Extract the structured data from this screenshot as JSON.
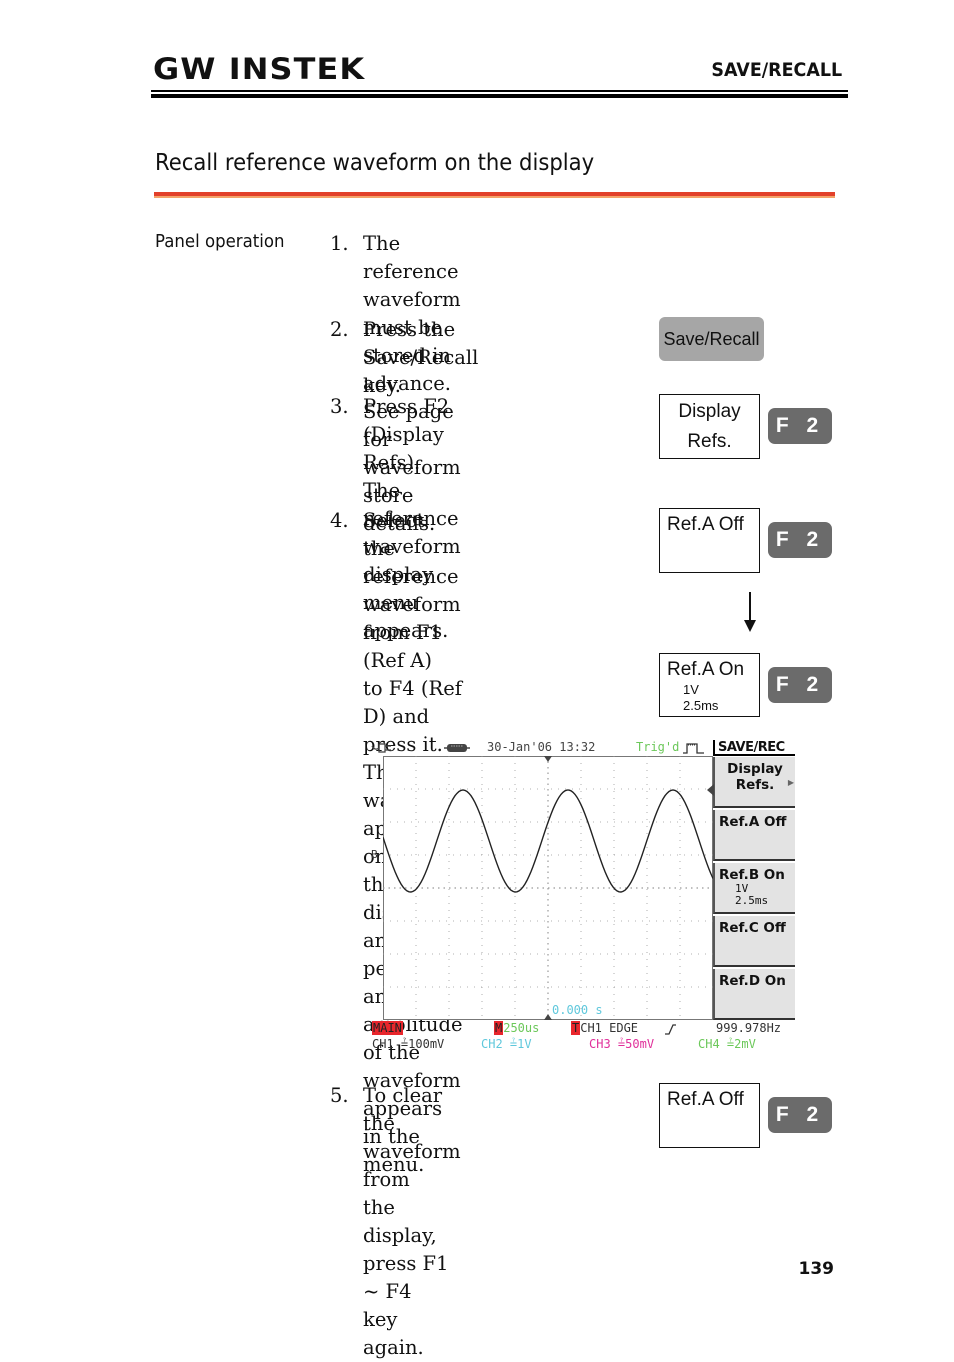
{
  "header": {
    "logo": "GW INSTEK",
    "chapter": "SAVE/RECALL"
  },
  "section": {
    "title": "Recall reference waveform on the display",
    "side_label": "Panel operation"
  },
  "steps": [
    {
      "num": "1.",
      "lines": [
        "The reference waveform must be stored in",
        "advance. See page for waveform store details."
      ]
    },
    {
      "num": "2.",
      "lines": [
        "Press the Save/Recall key."
      ]
    },
    {
      "num": "3.",
      "lines": [
        "Press F2 (Display Refs). The",
        "reference waveform display",
        "menu appears."
      ]
    },
    {
      "num": "4.",
      "lines": [
        "Select the reference",
        "waveform from F1 (Ref A)",
        "to F4 (Ref D) and press it.",
        "The waveform appears on",
        "the display and the period",
        "and amplitude of the",
        "waveform appears in the",
        "menu."
      ]
    },
    {
      "num": "5.",
      "lines": [
        "To clear the waveform from",
        "the display, press F1 ~ F4",
        "key again."
      ]
    }
  ],
  "keys": {
    "save_recall": "Save/Recall",
    "display_refs": [
      "Display",
      "Refs."
    ],
    "refa_off": "Ref.A Off",
    "refa_on": "Ref.A On",
    "refa_on_amp": "1V",
    "refa_on_period": "2.5ms",
    "f2": "F 2"
  },
  "scope": {
    "datetime": "30-Jan'06 13:32",
    "trig_status": "Trig'd",
    "ref_marker": "B",
    "time_offset": "0.000 s",
    "menu": {
      "title": "SAVE/REC",
      "items": [
        {
          "label": [
            "Display",
            "Refs."
          ],
          "sub": []
        },
        {
          "label": [
            "Ref.A Off"
          ],
          "sub": []
        },
        {
          "label": [
            "Ref.B  On"
          ],
          "sub": [
            "1V",
            "2.5ms"
          ]
        },
        {
          "label": [
            "Ref.C  Off"
          ],
          "sub": []
        },
        {
          "label": [
            "Ref.D  On"
          ],
          "sub": []
        }
      ]
    },
    "status": {
      "mode": "MAIN",
      "timebase_tag": "M",
      "timebase": "250us",
      "trig_tag": "T",
      "trigger": "CH1  EDGE",
      "frequency": "999.978Hz"
    },
    "channels": [
      {
        "name": "CH1",
        "scale": "100mV",
        "color": "#333333"
      },
      {
        "name": "CH2",
        "scale": "1V",
        "color": "#5fc8dc"
      },
      {
        "name": "CH3",
        "scale": "50mV",
        "color": "#e0309a"
      },
      {
        "name": "CH4",
        "scale": "2mV",
        "color": "#6cc85a"
      }
    ],
    "colors": {
      "trig": "#6cc85a",
      "timebase": "#6cc85a",
      "offset": "#5fc8dc"
    }
  },
  "page_number": "139"
}
